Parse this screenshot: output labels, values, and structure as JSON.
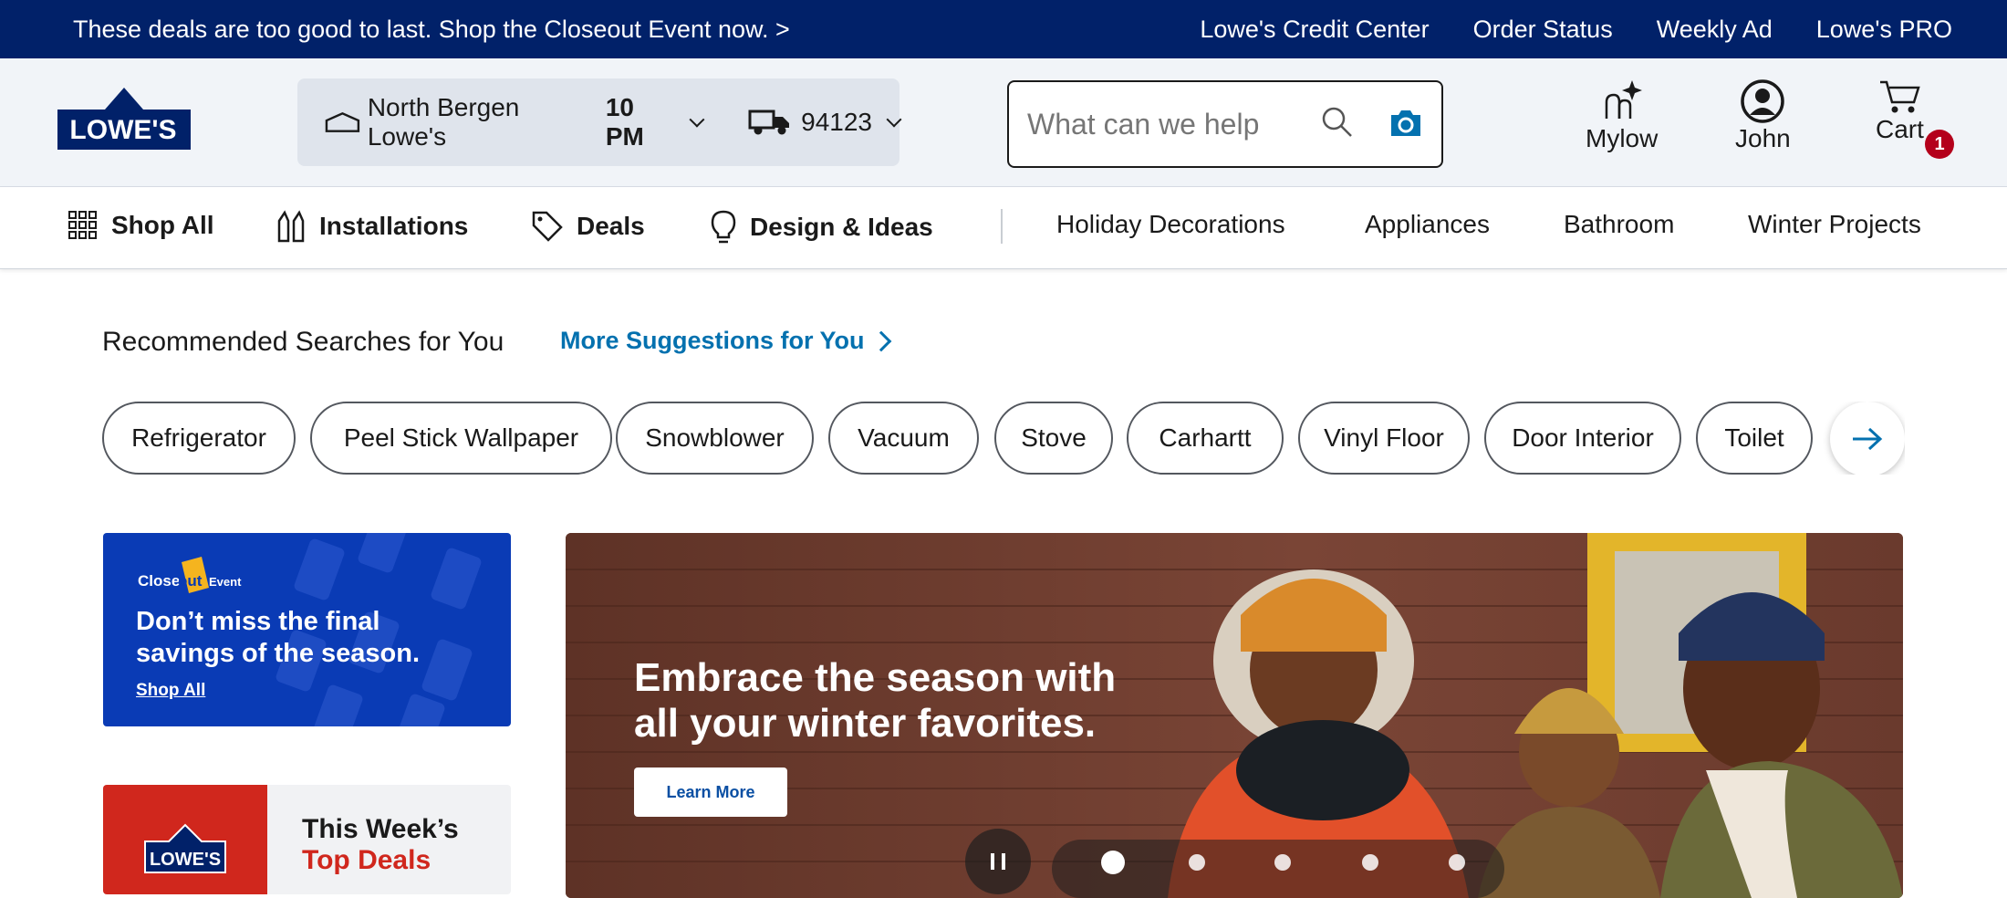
{
  "promo": {
    "text": "These deals are too good to last. Shop the Closeout Event now. >",
    "links": [
      "Lowe's Credit Center",
      "Order Status",
      "Weekly Ad",
      "Lowe's PRO"
    ]
  },
  "header": {
    "logo_text": "LOWE'S",
    "store_name": "North Bergen Lowe's",
    "store_hours": "10 PM",
    "zip": "94123",
    "search_placeholder": "What can we help",
    "mylow_label": "Mylow",
    "account_label": "John",
    "cart_label": "Cart",
    "cart_count": "1"
  },
  "nav": {
    "primary": [
      "Shop All",
      "Installations",
      "Deals",
      "Design & Ideas"
    ],
    "secondary": [
      "Holiday Decorations",
      "Appliances",
      "Bathroom",
      "Winter Projects"
    ]
  },
  "recommended": {
    "title": "Recommended Searches for You",
    "more_link": "More Suggestions for You",
    "chips": [
      "Refrigerator",
      "Peel Stick Wallpaper",
      "Snowblower",
      "Vacuum",
      "Stove",
      "Carhartt",
      "Vinyl Floor",
      "Door Interior",
      "Toilet"
    ]
  },
  "closeout_card": {
    "brand_close": "Close",
    "brand_out": "out",
    "brand_event": "Event",
    "headline": "Don’t miss the final savings of the season.",
    "cta": "Shop All"
  },
  "deals_card": {
    "logo_text": "LOWE'S",
    "line1": "This Week’s",
    "line2": "Top Deals"
  },
  "hero": {
    "headline": "Embrace the season with all your winter favorites.",
    "cta": "Learn More",
    "slide_count": 5,
    "active_slide": 1
  },
  "colors": {
    "brand_blue": "#012169",
    "link_blue": "#0471af",
    "badge_red": "#b4001b",
    "closeout_blue": "#0a3bb5",
    "deals_red": "#d0271d"
  }
}
